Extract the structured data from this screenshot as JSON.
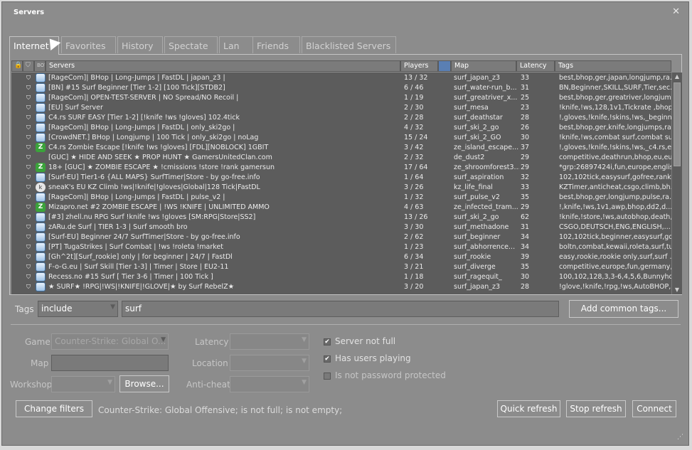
{
  "window": {
    "title": "Servers",
    "close_icon": "close-icon"
  },
  "tabs": [
    {
      "label": "Internet",
      "active": true
    },
    {
      "label": "Favorites"
    },
    {
      "label": "History"
    },
    {
      "label": "Spectate"
    },
    {
      "label": "Lan"
    },
    {
      "label": "Friends"
    },
    {
      "label": "Blacklisted Servers"
    }
  ],
  "columns": {
    "lock_icon": "lock-icon",
    "secure_icon": "shield-icon",
    "bot_icon": "bot-icon",
    "servers": "Servers",
    "players": "Players",
    "map_icon": "map-icon",
    "map": "Map",
    "latency": "Latency",
    "tags": "Tags"
  },
  "servers": [
    {
      "icon": "csgo",
      "name": "[RageCom]| BHop | Long-Jumps | FastDL | japan_z3 |",
      "players": "13 / 32",
      "map": "surf_japan_z3",
      "latency": "33",
      "tags": "best,bhop,ger,japan,longjump,ra..."
    },
    {
      "icon": "csgo",
      "name": "[BN] #15 Surf Beginner [Tier 1-2] [100 Tick][STDB2]",
      "players": "6 / 46",
      "map": "surf_water-run_b...",
      "latency": "31",
      "tags": "BN,Beginner,SKILL,SURF,Tier,sec..."
    },
    {
      "icon": "csgo",
      "name": "[RageCom]| OPEN-TEST-SERVER | NO Spread/NO Recoil |",
      "players": "1 / 19",
      "map": "surf_greatriver_x...",
      "latency": "25",
      "tags": "best,bhop,ger,greatriver,longjum..."
    },
    {
      "icon": "csgo",
      "name": "[EU] Surf Server",
      "players": "2 / 30",
      "map": "surf_mesa",
      "latency": "23",
      "tags": "!knife,!ws,128,1v1,Tickrate ,bhop,..."
    },
    {
      "icon": "csgo",
      "name": "C4.rs SURF EASY [Tier 1-2] [!knife !ws !gloves] 102.4tick",
      "players": "2 / 28",
      "map": "surf_deathstar",
      "latency": "28",
      "tags": "!,gloves,!knife,!skins,!ws,_beginn..."
    },
    {
      "icon": "csgo",
      "name": "[RageCom]| BHop | Long-Jumps | FastDL | only_ski2go |",
      "players": "4 / 32",
      "map": "surf_ski_2_go",
      "latency": "26",
      "tags": "best,bhop,ger,knife,longjumps,ra..."
    },
    {
      "icon": "csgo",
      "name": "[CrowdNET.] BHop | Longjump | 100 Tick | only_ski2go | noLag",
      "players": "15 / 24",
      "map": "surf_ski_2_GO",
      "latency": "30",
      "tags": "!knife,!ws,combat surf,combat sur..."
    },
    {
      "icon": "z",
      "name": "C4.rs Zombie Escape [!knife !ws !gloves] [FDL][NOBLOCK] 1GBIT",
      "players": "3 / 42",
      "map": "ze_island_escape...",
      "latency": "37",
      "tags": "!,gloves,!knife,!skins,!ws,_c4.rs,e..."
    },
    {
      "icon": "none",
      "name": "[GUC] ★  HIDE AND SEEK ★  PROP HUNT ★  GamersUnitedClan.com",
      "players": "2 / 32",
      "map": "de_dust2",
      "latency": "29",
      "tags": "competitive,deathrun,bhop,eu,eu..."
    },
    {
      "icon": "z",
      "name": "18+ [GUC] ★  ZOMBIE ESCAPE ★ !cmissions !store !rank gamersun",
      "players": "17 / 64",
      "map": "ze_shroomforest3...",
      "latency": "29",
      "tags": "*grp:26897424i,fun,europe,englis..."
    },
    {
      "icon": "csgo",
      "name": "[Surf-EU] Tier1-6 {ALL MAPS} SurfTimer|Store  - by go-free.info",
      "players": "1 / 64",
      "map": "surf_aspiration",
      "latency": "32",
      "tags": "102,102tick,easysurf,gofree,rank,..."
    },
    {
      "icon": "k",
      "name": "sneaK's EU KZ Climb !ws|!knife|!gloves|Global|128 Tick|FastDL",
      "players": "3 / 26",
      "map": "kz_life_final",
      "latency": "33",
      "tags": "KZTimer,anticheat,csgo,climb,bh..."
    },
    {
      "icon": "csgo",
      "name": "[RageCom]| BHop | Long-Jumps | FastDL | pulse_v2 |",
      "players": "1 / 32",
      "map": "surf_pulse_v2",
      "latency": "35",
      "tags": "best,bhop,ger,longjump,pulse,ra..."
    },
    {
      "icon": "z",
      "name": "Mizapro.net #2 ZOMBIE ESCAPE | !WS !KNIFE | UNLIMITED AMMO",
      "players": "4 / 63",
      "map": "ze_infected_tram...",
      "latency": "29",
      "tags": "!,knife,!ws,1v1,awp,bhop,dd2,d..."
    },
    {
      "icon": "csgo",
      "name": "[#3] zhell.nu RPG Surf !knife !ws !gloves [SM:RPG|Store|SS2]",
      "players": "13 / 26",
      "map": "surf_ski_2_go",
      "latency": "62",
      "tags": "!knife,!store,!ws,autobhop,death,..."
    },
    {
      "icon": "csgo",
      "name": "zARu.de Surf | TIER 1-3 | Surf smooth bro",
      "players": "3 / 30",
      "map": "surf_methadone",
      "latency": "31",
      "tags": "CSGO,DEUTSCH,ENG,ENGLISH,..."
    },
    {
      "icon": "csgo",
      "name": "[Surf-EU] Beginner 24/7 SurfTimer|Store - by go-free.info",
      "players": "2 / 62",
      "map": "surf_beginner",
      "latency": "34",
      "tags": "102,102tick,beginner,easysurf,gof..."
    },
    {
      "icon": "csgo",
      "name": "[PT] TugaStrikes | Surf Combat | !ws !roleta !market",
      "players": "1 / 23",
      "map": "surf_abhorrence...",
      "latency": "34",
      "tags": "boltn,combat,kewaii,roleta,surf,tu..."
    },
    {
      "icon": "csgo",
      "name": "[Gh^2t][Surf_rookie] only | for beginner | 24/7 | FastDl",
      "players": "6 / 34",
      "map": "surf_rookie",
      "latency": "39",
      "tags": "easy,rookie,rookie only,surf,surf ..."
    },
    {
      "icon": "csgo",
      "name": "F-o-G.eu | Surf Skill [Tier 1-3] | Timer | Store | EU2-11",
      "players": "3 / 21",
      "map": "surf_diverge",
      "latency": "35",
      "tags": "competitive,europe,fun,germany,..."
    },
    {
      "icon": "csgo",
      "name": "Recess.no #15 Surf [ Tier 3-6 | Timer | 100 Tick ]",
      "players": "1 / 18",
      "map": "surf_ragequit_",
      "latency": "30",
      "tags": "100,102,128,3,3-6,4,5,6,Bunnyho..."
    },
    {
      "icon": "csgo",
      "name": "★ SURF★ !RPG|!WS|!KNIFE|!GLOVE|★ by Surf RebelZ★",
      "players": "3 / 20",
      "map": "surf_japan_z3",
      "latency": "28",
      "tags": "!glove,!knife,!rpg,!ws,AutoBHOP,..."
    }
  ],
  "tags_filter": {
    "label": "Tags",
    "mode": "include",
    "value": "surf",
    "add_button": "Add common tags..."
  },
  "filters": {
    "game_label": "Game",
    "game_value": "Counter-Strike: Global O...",
    "map_label": "Map",
    "map_value": "",
    "workshop_label": "Workshop",
    "workshop_value": "",
    "browse_button": "Browse...",
    "latency_label": "Latency",
    "latency_value": "",
    "location_label": "Location",
    "location_value": "",
    "anticheat_label": "Anti-cheat",
    "anticheat_value": ""
  },
  "checkboxes": [
    {
      "label": "Server not full",
      "checked": true
    },
    {
      "label": "Has users playing",
      "checked": true
    },
    {
      "label": "Is not password protected",
      "checked": false
    }
  ],
  "footer": {
    "change_filters": "Change filters",
    "status": "Counter-Strike: Global Offensive; is not full; is not empty;",
    "quick_refresh": "Quick refresh",
    "stop_refresh": "Stop refresh",
    "connect": "Connect"
  }
}
